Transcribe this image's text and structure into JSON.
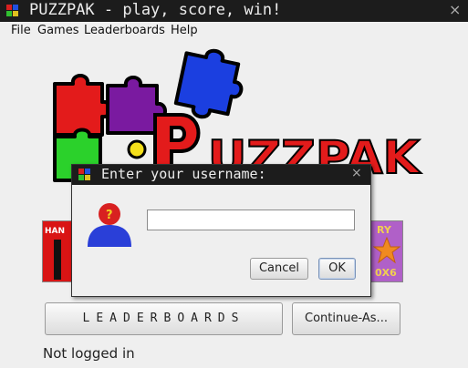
{
  "window": {
    "title": "PUZZPAK - play, score, win!",
    "close_glyph": "×",
    "icon": "puzzle-piece-icon"
  },
  "menu": {
    "items": [
      {
        "label": "File"
      },
      {
        "label": "Games"
      },
      {
        "label": "Leaderboards"
      },
      {
        "label": "Help"
      }
    ]
  },
  "logo": {
    "text": "PUZZPAK",
    "colors": [
      "#e31b1b",
      "#7a1aa0",
      "#1b3fe0",
      "#2bd12b",
      "#f5e01a",
      "#f57a1a"
    ]
  },
  "tiles": {
    "left": {
      "label": "HAN"
    },
    "right": {
      "label_top": "RY",
      "label_bottom": "0X6"
    }
  },
  "buttons": {
    "leaderboards": "LEADERBOARDS",
    "continue_as": "Continue-As..."
  },
  "status": "Not logged in",
  "dialog": {
    "title": "Enter your username:",
    "close_glyph": "×",
    "username_value": "",
    "cancel_label": "Cancel",
    "ok_label": "OK",
    "avatar_icon": "user-question-icon"
  }
}
